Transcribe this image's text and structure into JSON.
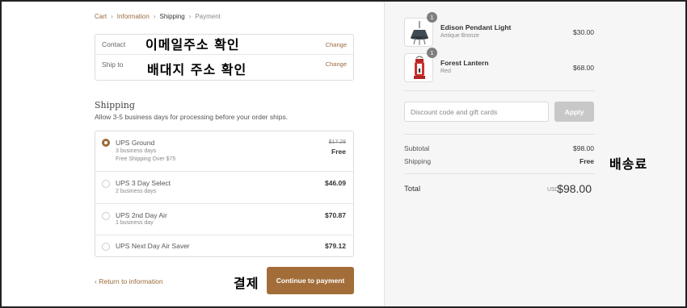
{
  "breadcrumb": {
    "cart": "Cart",
    "information": "Information",
    "shipping": "Shipping",
    "payment": "Payment"
  },
  "review": {
    "contact_label": "Contact",
    "contact_change": "Change",
    "shipto_label": "Ship to",
    "shipto_change": "Change"
  },
  "annotations": {
    "email": "이메일주소 확인",
    "ship_address": "배대지 주소 확인",
    "payment": "결제",
    "shipping_fee": "배송료"
  },
  "shipping": {
    "title": "Shipping",
    "subtitle": "Allow 3-5 business days for processing before your order ships.",
    "methods": [
      {
        "name": "UPS Ground",
        "sub1": "3 business days",
        "sub2": "Free Shipping Over $75",
        "old_price": "$17.28",
        "price": "Free",
        "selected": true
      },
      {
        "name": "UPS 3 Day Select",
        "sub1": "2 business days",
        "price": "$46.09",
        "selected": false
      },
      {
        "name": "UPS 2nd Day Air",
        "sub1": "1 business day",
        "price": "$70.87",
        "selected": false
      },
      {
        "name": "UPS Next Day Air Saver",
        "price": "$79.12",
        "selected": false
      }
    ]
  },
  "footer": {
    "return_label": "Return to information",
    "continue_label": "Continue to payment"
  },
  "order": {
    "products": [
      {
        "qty": "1",
        "name": "Edison Pendant Light",
        "variant": "Antique Bronze",
        "price": "$30.00",
        "icon": "pendant-light-icon"
      },
      {
        "qty": "1",
        "name": "Forest Lantern",
        "variant": "Red",
        "price": "$68.00",
        "icon": "lantern-icon"
      }
    ],
    "discount_placeholder": "Discount code and gift cards",
    "apply_label": "Apply",
    "subtotal_label": "Subtotal",
    "subtotal_value": "$98.00",
    "shipping_label": "Shipping",
    "shipping_value": "Free",
    "total_label": "Total",
    "total_currency": "USD",
    "total_value": "$98.00"
  },
  "colors": {
    "accent": "#9b6a3c",
    "button": "#a26d39",
    "apply_disabled": "#c8c8c8",
    "sidebar_bg": "#f6f6f6"
  }
}
